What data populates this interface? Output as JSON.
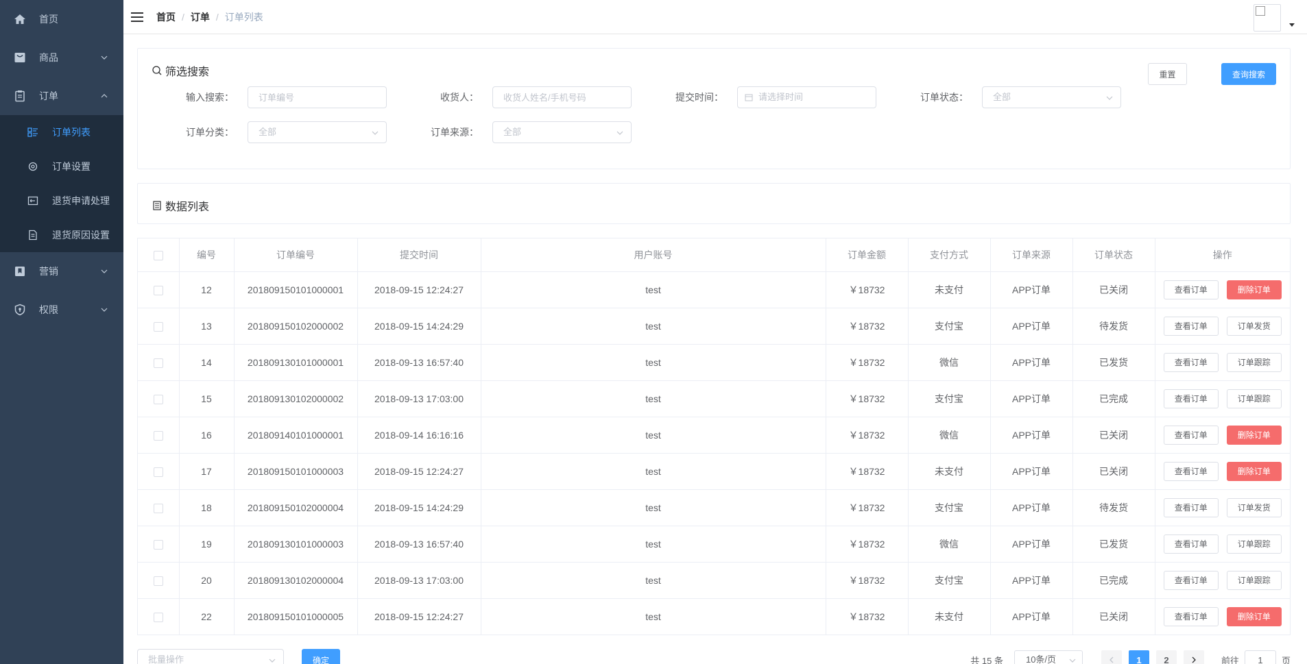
{
  "sidebar": {
    "items": [
      {
        "label": "首页",
        "icon": "home-icon"
      },
      {
        "label": "商品",
        "icon": "shopping-bag-icon"
      },
      {
        "label": "订单",
        "icon": "clipboard-icon"
      },
      {
        "label": "营销",
        "icon": "bookmark-icon"
      },
      {
        "label": "权限",
        "icon": "shield-icon"
      }
    ],
    "order_sub": [
      {
        "label": "订单列表",
        "icon": "list-icon",
        "active": true
      },
      {
        "label": "订单设置",
        "icon": "gear-icon"
      },
      {
        "label": "退货申请处理",
        "icon": "return-icon"
      },
      {
        "label": "退货原因设置",
        "icon": "document-icon"
      }
    ]
  },
  "breadcrumb": {
    "home": "首页",
    "section": "订单",
    "sep": "/",
    "current": "订单列表"
  },
  "filter": {
    "title": "筛选搜索",
    "reset_label": "重置",
    "query_label": "查询搜索",
    "search_label": "输入搜索：",
    "search_placeholder": "订单编号",
    "receiver_label": "收货人：",
    "receiver_placeholder": "收货人姓名/手机号码",
    "time_label": "提交时间：",
    "time_placeholder": "请选择时间",
    "status_label": "订单状态：",
    "status_value": "全部",
    "category_label": "订单分类：",
    "category_value": "全部",
    "source_label": "订单来源：",
    "source_value": "全部"
  },
  "list": {
    "title": "数据列表"
  },
  "table": {
    "headers": [
      "编号",
      "订单编号",
      "提交时间",
      "用户账号",
      "订单金额",
      "支付方式",
      "订单来源",
      "订单状态",
      "操作"
    ],
    "view_label": "查看订单",
    "rows": [
      {
        "id": "12",
        "sn": "201809150101000001",
        "time": "2018-09-15 12:24:27",
        "user": "test",
        "amount": "￥18732",
        "pay": "未支付",
        "source": "APP订单",
        "status": "已关闭",
        "action": "删除订单",
        "danger": true
      },
      {
        "id": "13",
        "sn": "201809150102000002",
        "time": "2018-09-15 14:24:29",
        "user": "test",
        "amount": "￥18732",
        "pay": "支付宝",
        "source": "APP订单",
        "status": "待发货",
        "action": "订单发货",
        "danger": false
      },
      {
        "id": "14",
        "sn": "201809130101000001",
        "time": "2018-09-13 16:57:40",
        "user": "test",
        "amount": "￥18732",
        "pay": "微信",
        "source": "APP订单",
        "status": "已发货",
        "action": "订单跟踪",
        "danger": false
      },
      {
        "id": "15",
        "sn": "201809130102000002",
        "time": "2018-09-13 17:03:00",
        "user": "test",
        "amount": "￥18732",
        "pay": "支付宝",
        "source": "APP订单",
        "status": "已完成",
        "action": "订单跟踪",
        "danger": false
      },
      {
        "id": "16",
        "sn": "201809140101000001",
        "time": "2018-09-14 16:16:16",
        "user": "test",
        "amount": "￥18732",
        "pay": "微信",
        "source": "APP订单",
        "status": "已关闭",
        "action": "删除订单",
        "danger": true
      },
      {
        "id": "17",
        "sn": "201809150101000003",
        "time": "2018-09-15 12:24:27",
        "user": "test",
        "amount": "￥18732",
        "pay": "未支付",
        "source": "APP订单",
        "status": "已关闭",
        "action": "删除订单",
        "danger": true
      },
      {
        "id": "18",
        "sn": "201809150102000004",
        "time": "2018-09-15 14:24:29",
        "user": "test",
        "amount": "￥18732",
        "pay": "支付宝",
        "source": "APP订单",
        "status": "待发货",
        "action": "订单发货",
        "danger": false
      },
      {
        "id": "19",
        "sn": "201809130101000003",
        "time": "2018-09-13 16:57:40",
        "user": "test",
        "amount": "￥18732",
        "pay": "微信",
        "source": "APP订单",
        "status": "已发货",
        "action": "订单跟踪",
        "danger": false
      },
      {
        "id": "20",
        "sn": "201809130102000004",
        "time": "2018-09-13 17:03:00",
        "user": "test",
        "amount": "￥18732",
        "pay": "支付宝",
        "source": "APP订单",
        "status": "已完成",
        "action": "订单跟踪",
        "danger": false
      },
      {
        "id": "22",
        "sn": "201809150101000005",
        "time": "2018-09-15 12:24:27",
        "user": "test",
        "amount": "￥18732",
        "pay": "未支付",
        "source": "APP订单",
        "status": "已关闭",
        "action": "删除订单",
        "danger": true
      }
    ]
  },
  "bottom": {
    "batch_placeholder": "批量操作",
    "confirm_label": "确定",
    "total": "共 15 条",
    "page_size": "10条/页",
    "pages": [
      "1",
      "2"
    ],
    "current_page": "1",
    "goto_label": "前往",
    "goto_value": "1",
    "page_suffix": "页"
  },
  "colors": {
    "sidebar_bg": "#304156",
    "submenu_bg": "#1f2d3d",
    "primary": "#409eff",
    "danger": "#f56c6c"
  }
}
